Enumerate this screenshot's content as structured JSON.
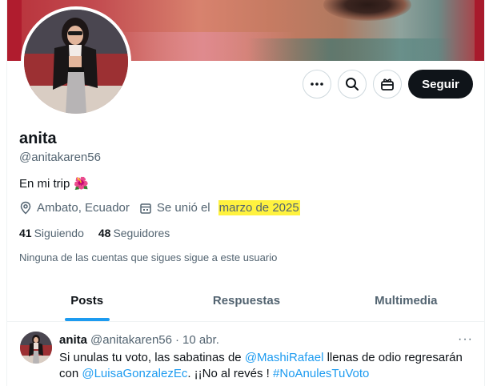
{
  "profile": {
    "name": "anita",
    "handle": "@anitakaren56",
    "bio": "En mi trip",
    "bio_emoji": "🌺",
    "location": "Ambato, Ecuador",
    "joined_prefix": "Se unió el",
    "joined_date": "marzo de 2025",
    "following_count": "41",
    "following_label": "Siguiendo",
    "followers_count": "48",
    "followers_label": "Seguidores",
    "mutual_notice": "Ninguna de las cuentas que sigues sigue a este usuario"
  },
  "actions": {
    "follow_label": "Seguir",
    "more_icon": "more-icon",
    "search_icon": "search-icon",
    "gift_icon": "gift-icon"
  },
  "tabs": [
    {
      "label": "Posts",
      "active": true
    },
    {
      "label": "Respuestas",
      "active": false
    },
    {
      "label": "Multimedia",
      "active": false
    }
  ],
  "tweet": {
    "author": "anita",
    "handle": "@anitakaren56",
    "separator": "·",
    "date": "10 abr.",
    "more": "···",
    "text_part1": "Si unulas tu voto, las sabatinas de ",
    "mention1": "@MashiRafael",
    "text_part2": " llenas de odio regresarán con ",
    "mention2": "@LuisaGonzalezEc",
    "text_part3": ". ¡¡No al revés ! ",
    "hashtag": "#NoAnulesTuVoto"
  },
  "colors": {
    "accent": "#1d9bf0",
    "highlight": "#fff23f",
    "follow_bg": "#0f1419"
  }
}
